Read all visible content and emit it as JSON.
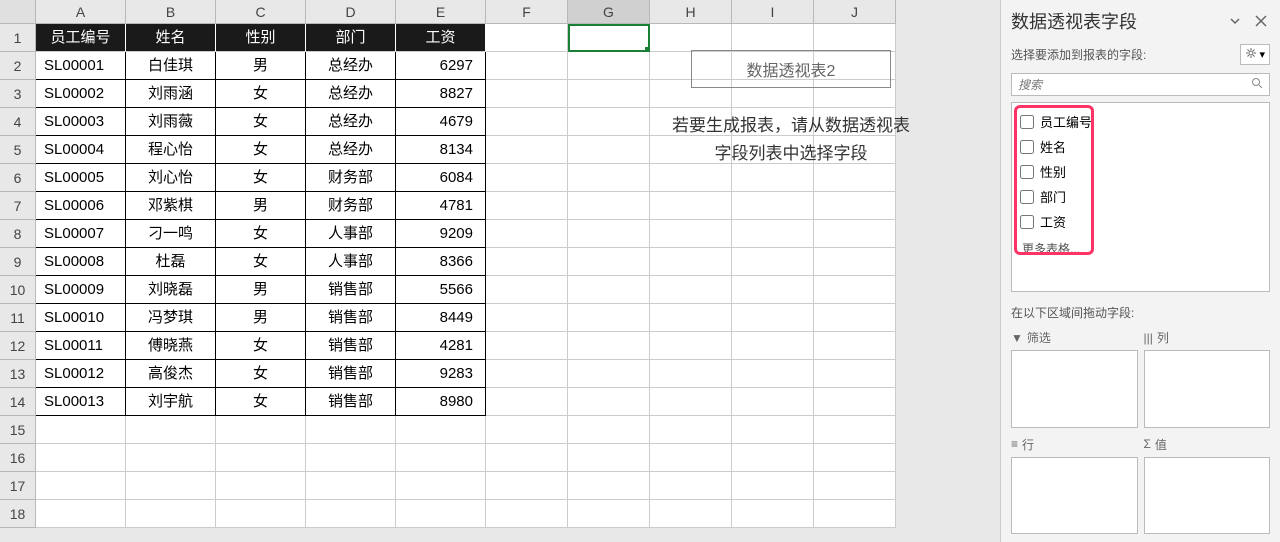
{
  "columns": [
    "A",
    "B",
    "C",
    "D",
    "E",
    "F",
    "G",
    "H",
    "I",
    "J"
  ],
  "rowCount": 18,
  "headers": [
    "员工编号",
    "姓名",
    "性别",
    "部门",
    "工资"
  ],
  "data": [
    {
      "id": "SL00001",
      "name": "白佳琪",
      "gender": "男",
      "dept": "总经办",
      "salary": "6297"
    },
    {
      "id": "SL00002",
      "name": "刘雨涵",
      "gender": "女",
      "dept": "总经办",
      "salary": "8827"
    },
    {
      "id": "SL00003",
      "name": "刘雨薇",
      "gender": "女",
      "dept": "总经办",
      "salary": "4679"
    },
    {
      "id": "SL00004",
      "name": "程心怡",
      "gender": "女",
      "dept": "总经办",
      "salary": "8134"
    },
    {
      "id": "SL00005",
      "name": "刘心怡",
      "gender": "女",
      "dept": "财务部",
      "salary": "6084"
    },
    {
      "id": "SL00006",
      "name": "邓紫棋",
      "gender": "男",
      "dept": "财务部",
      "salary": "4781"
    },
    {
      "id": "SL00007",
      "name": "刁一鸣",
      "gender": "女",
      "dept": "人事部",
      "salary": "9209"
    },
    {
      "id": "SL00008",
      "name": "杜磊",
      "gender": "女",
      "dept": "人事部",
      "salary": "8366"
    },
    {
      "id": "SL00009",
      "name": "刘晓磊",
      "gender": "男",
      "dept": "销售部",
      "salary": "5566"
    },
    {
      "id": "SL00010",
      "name": "冯梦琪",
      "gender": "男",
      "dept": "销售部",
      "salary": "8449"
    },
    {
      "id": "SL00011",
      "name": "傅晓燕",
      "gender": "女",
      "dept": "销售部",
      "salary": "4281"
    },
    {
      "id": "SL00012",
      "name": "高俊杰",
      "gender": "女",
      "dept": "销售部",
      "salary": "9283"
    },
    {
      "id": "SL00013",
      "name": "刘宇航",
      "gender": "女",
      "dept": "销售部",
      "salary": "8980"
    }
  ],
  "pivot": {
    "title": "数据透视表2",
    "hint_line1": "若要生成报表，请从数据透视表",
    "hint_line2": "字段列表中选择字段"
  },
  "fieldPane": {
    "title": "数据透视表字段",
    "subtitle": "选择要添加到报表的字段:",
    "search_placeholder": "搜索",
    "fields": [
      "员工编号",
      "姓名",
      "性别",
      "部门",
      "工资"
    ],
    "more_tables": "更多表格...",
    "drag_title": "在以下区域间拖动字段:",
    "areas": {
      "filter": "筛选",
      "columns": "列",
      "rows": "行",
      "values": "值"
    }
  },
  "selected_cell": "G1"
}
